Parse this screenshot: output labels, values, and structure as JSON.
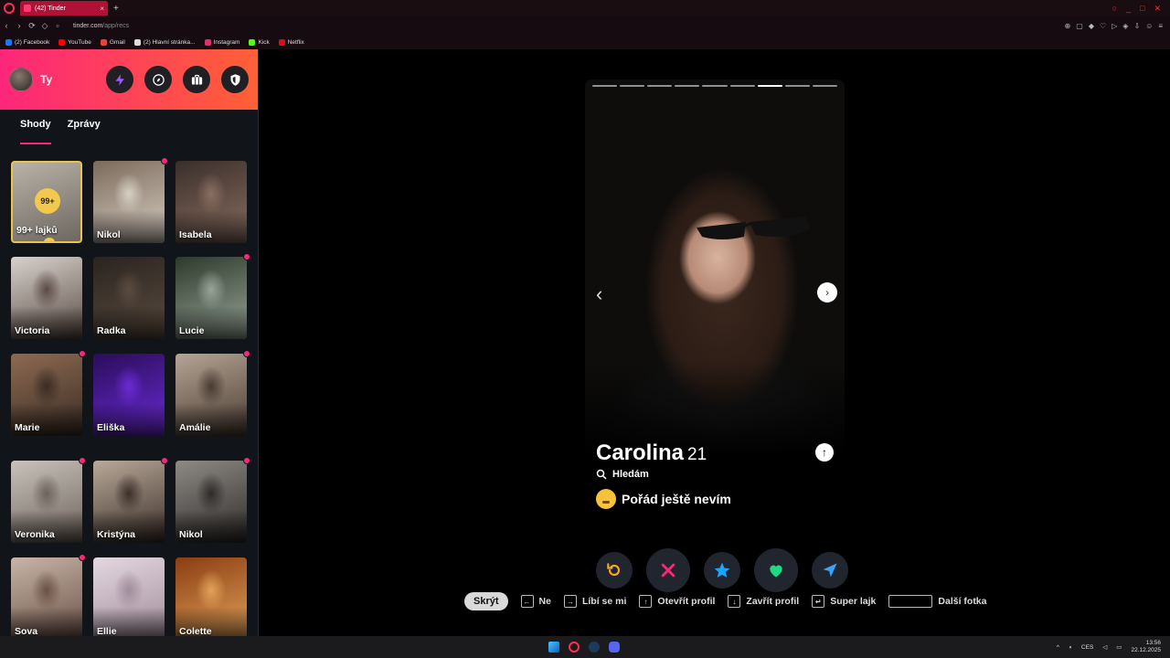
{
  "browser": {
    "tab_title": "(42) Tinder",
    "tab_close": "×",
    "new_tab": "+",
    "url_host": "tinder.com",
    "url_path": "/app/recs",
    "nav_back": "‹",
    "nav_forward": "›",
    "nav_reload": "⟳",
    "bookmarks": [
      {
        "label": "(2) Facebook",
        "color": "#1877f2"
      },
      {
        "label": "YouTube",
        "color": "#ff0000"
      },
      {
        "label": "Gmail",
        "color": "#ea4335"
      },
      {
        "label": "(2) Hlavní stránka...",
        "color": "#dddddd"
      },
      {
        "label": "Instagram",
        "color": "#e1306c"
      },
      {
        "label": "Kick",
        "color": "#53fc18"
      },
      {
        "label": "Netflix",
        "color": "#e50914"
      }
    ]
  },
  "sidebar": {
    "user_name": "Ty",
    "header_buttons": [
      "lightning-icon",
      "compass-icon",
      "briefcase-icon",
      "shield-icon"
    ],
    "tabs": [
      {
        "label": "Shody",
        "active": true
      },
      {
        "label": "Zprávy",
        "active": false
      }
    ],
    "likes_card": {
      "badge": "99+",
      "label": "99+ lajků"
    },
    "matches": [
      {
        "name": "Nikol",
        "new": true
      },
      {
        "name": "Isabela",
        "new": false
      },
      {
        "name": "Victoria",
        "new": false
      },
      {
        "name": "Radka",
        "new": false
      },
      {
        "name": "Lucie",
        "new": true
      },
      {
        "name": "Marie",
        "new": true
      },
      {
        "name": "Eliška",
        "new": false
      },
      {
        "name": "Amálie",
        "new": true
      },
      {
        "name": "Veronika",
        "new": true
      },
      {
        "name": "Kristýna",
        "new": true
      },
      {
        "name": "Nikol",
        "new": true
      },
      {
        "name": "Sova",
        "new": true
      },
      {
        "name": "Ellie",
        "new": false
      },
      {
        "name": "Colette",
        "new": false
      }
    ]
  },
  "profile": {
    "name": "Carolina",
    "age": "21",
    "looking_label": "Hledám",
    "status": "Pořád ještě nevím",
    "photo_count": 9,
    "active_photo": 7,
    "info_icon": "↑",
    "prev_arrow": "‹",
    "next_arrow": "›"
  },
  "actions": [
    "rewind-icon",
    "nope-icon",
    "super-like-icon",
    "like-icon",
    "boost-icon"
  ],
  "shortcuts": {
    "hide": "Skrýt",
    "items": [
      {
        "key": "←",
        "label": "Ne"
      },
      {
        "key": "→",
        "label": "Líbí se mi"
      },
      {
        "key": "↑",
        "label": "Otevřít profil"
      },
      {
        "key": "↓",
        "label": "Zavřít profil"
      },
      {
        "key": "↵",
        "label": "Super lajk"
      }
    ],
    "space_label": "Další fotka"
  },
  "taskbar": {
    "language": "CES",
    "time": "13:56",
    "date": "22.12.2025"
  },
  "colors": {
    "brand_start": "#fd267a",
    "brand_end": "#ff6036",
    "nope": "#fd267a",
    "super_like": "#1ca4fc",
    "like": "#1bdb86",
    "rewind": "#f5a623",
    "boost": "#3aa2ff"
  }
}
